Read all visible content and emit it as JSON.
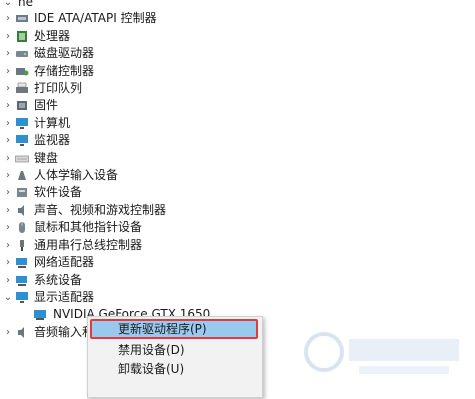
{
  "tree": {
    "top_partial_label": "ne",
    "categories": [
      {
        "label": "IDE ATA/ATAPI 控制器",
        "icon": "ide-controller-icon",
        "expanded": false
      },
      {
        "label": "处理器",
        "icon": "cpu-icon",
        "expanded": false
      },
      {
        "label": "磁盘驱动器",
        "icon": "disk-drive-icon",
        "expanded": false
      },
      {
        "label": "存储控制器",
        "icon": "storage-controller-icon",
        "expanded": false
      },
      {
        "label": "打印队列",
        "icon": "printer-icon",
        "expanded": false
      },
      {
        "label": "固件",
        "icon": "firmware-icon",
        "expanded": false
      },
      {
        "label": "计算机",
        "icon": "computer-icon",
        "expanded": false
      },
      {
        "label": "监视器",
        "icon": "monitor-icon",
        "expanded": false
      },
      {
        "label": "键盘",
        "icon": "keyboard-icon",
        "expanded": false
      },
      {
        "label": "人体学输入设备",
        "icon": "hid-icon",
        "expanded": false
      },
      {
        "label": "软件设备",
        "icon": "software-device-icon",
        "expanded": false
      },
      {
        "label": "声音、视频和游戏控制器",
        "icon": "speaker-icon",
        "expanded": false
      },
      {
        "label": "鼠标和其他指针设备",
        "icon": "mouse-icon",
        "expanded": false
      },
      {
        "label": "通用串行总线控制器",
        "icon": "usb-icon",
        "expanded": false
      },
      {
        "label": "网络适配器",
        "icon": "network-adapter-icon",
        "expanded": false
      },
      {
        "label": "系统设备",
        "icon": "system-device-icon",
        "expanded": false
      },
      {
        "label": "显示适配器",
        "icon": "display-adapter-icon",
        "expanded": true
      },
      {
        "label": "音频输入和",
        "icon": "audio-io-icon",
        "expanded": false
      }
    ],
    "child_device": {
      "label": "NVIDIA GeForce GTX 1650",
      "icon": "gpu-icon"
    }
  },
  "context_menu": {
    "items": [
      {
        "label": "更新驱动程序(P)",
        "highlighted": true
      },
      {
        "label": "禁用设备(D)",
        "highlighted": false
      },
      {
        "label": "卸载设备(U)",
        "highlighted": false
      },
      {
        "label": "",
        "highlighted": false
      }
    ]
  },
  "colors": {
    "highlight_fill": "#99c9ef",
    "highlight_border": "#e23b3b",
    "menu_background": "#f2f2f2"
  }
}
